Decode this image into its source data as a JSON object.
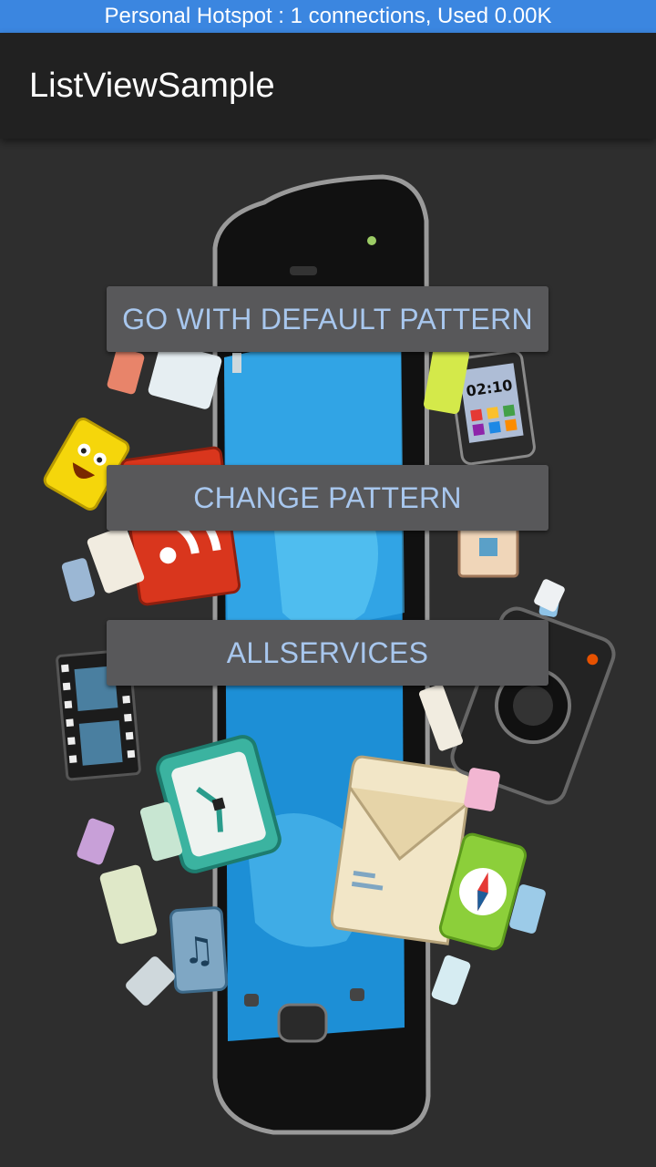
{
  "status_bar": {
    "text": "Personal Hotspot : 1 connections, Used 0.00K"
  },
  "app_bar": {
    "title": "ListViewSample"
  },
  "buttons": {
    "default_pattern": "GO WITH DEFAULT PATTERN",
    "change_pattern": "CHANGE PATTERN",
    "all_services": "ALLSERVICES"
  },
  "illustration": {
    "phone_clock_text": "02:10",
    "icons": [
      "smiley-icon",
      "rss-icon",
      "film-icon",
      "clock-icon",
      "envelope-icon",
      "compass-icon",
      "music-icon",
      "camera-icon",
      "house-icon",
      "tablet-clock-icon"
    ]
  },
  "colors": {
    "status_bar": "#3b86e0",
    "app_bar": "#212121",
    "background": "#2e2e2e",
    "button_bg": "#58585a",
    "button_text": "#a8c7ee"
  }
}
